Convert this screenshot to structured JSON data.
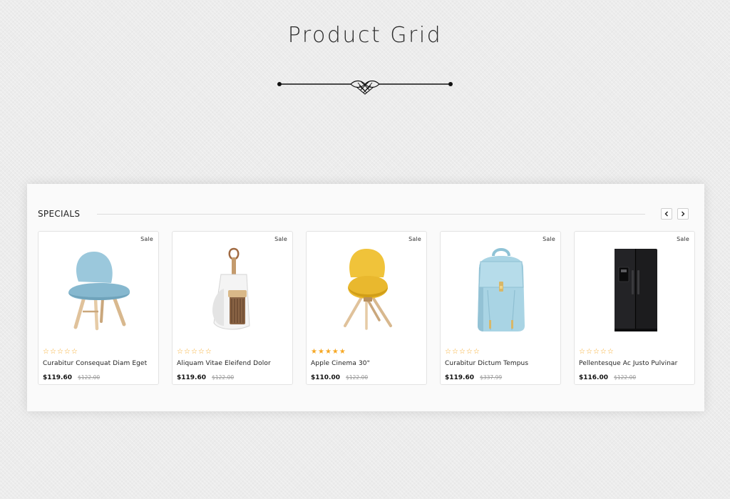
{
  "page": {
    "heading": "Product Grid"
  },
  "section": {
    "title": "SPECIALS",
    "prev_icon": "chevron-left-icon",
    "next_icon": "chevron-right-icon"
  },
  "colors": {
    "accent_star": "#f6a825",
    "text": "#222222",
    "old_price": "#999999"
  },
  "products": [
    {
      "badge": "Sale",
      "image_icon": "chair-icon",
      "name": "Curabitur Consequat Diam Eget",
      "price": "$119.60",
      "old_price": "$122.00",
      "rating": 0
    },
    {
      "badge": "Sale",
      "image_icon": "dustpan-brush-icon",
      "name": "Aliquam Vitae Eleifend Dolor",
      "price": "$119.60",
      "old_price": "$122.00",
      "rating": 0
    },
    {
      "badge": "Sale",
      "image_icon": "yellow-chair-icon",
      "name": "Apple Cinema 30\"",
      "price": "$110.00",
      "old_price": "$122.00",
      "rating": 5
    },
    {
      "badge": "Sale",
      "image_icon": "backpack-icon",
      "name": "Curabitur Dictum Tempus",
      "price": "$119.60",
      "old_price": "$337.99",
      "rating": 0
    },
    {
      "badge": "Sale",
      "image_icon": "refrigerator-icon",
      "name": "Pellentesque Ac Justo Pulvinar",
      "price": "$116.00",
      "old_price": "$122.00",
      "rating": 0
    }
  ]
}
